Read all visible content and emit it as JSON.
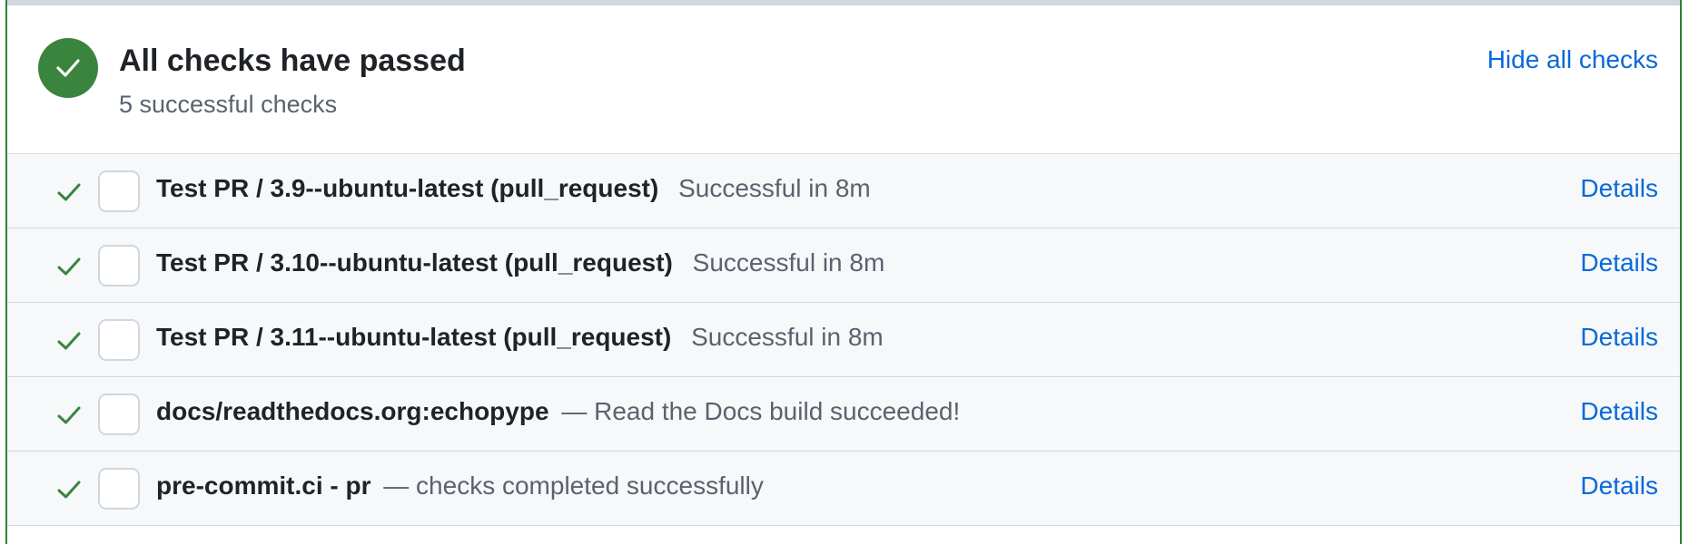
{
  "header": {
    "title": "All checks have passed",
    "subtitle": "5 successful checks",
    "hide_link": "Hide all checks"
  },
  "colors": {
    "success": "#3b843d",
    "link": "#0969da",
    "muted": "#59636e",
    "row_bg": "#f6f8fa"
  },
  "icons": {
    "status": "check-circle-icon",
    "row_status": "check-icon",
    "row_avatar": "app-avatar"
  },
  "checks": [
    {
      "name": "Test PR / 3.9--ubuntu-latest (pull_request)",
      "separator": "",
      "description": "Successful in 8m",
      "details": "Details"
    },
    {
      "name": "Test PR / 3.10--ubuntu-latest (pull_request)",
      "separator": "",
      "description": "Successful in 8m",
      "details": "Details"
    },
    {
      "name": "Test PR / 3.11--ubuntu-latest (pull_request)",
      "separator": "",
      "description": "Successful in 8m",
      "details": "Details"
    },
    {
      "name": "docs/readthedocs.org:echopype",
      "separator": "—",
      "description": "Read the Docs build succeeded!",
      "details": "Details"
    },
    {
      "name": "pre-commit.ci - pr",
      "separator": "—",
      "description": "checks completed successfully",
      "details": "Details"
    }
  ]
}
